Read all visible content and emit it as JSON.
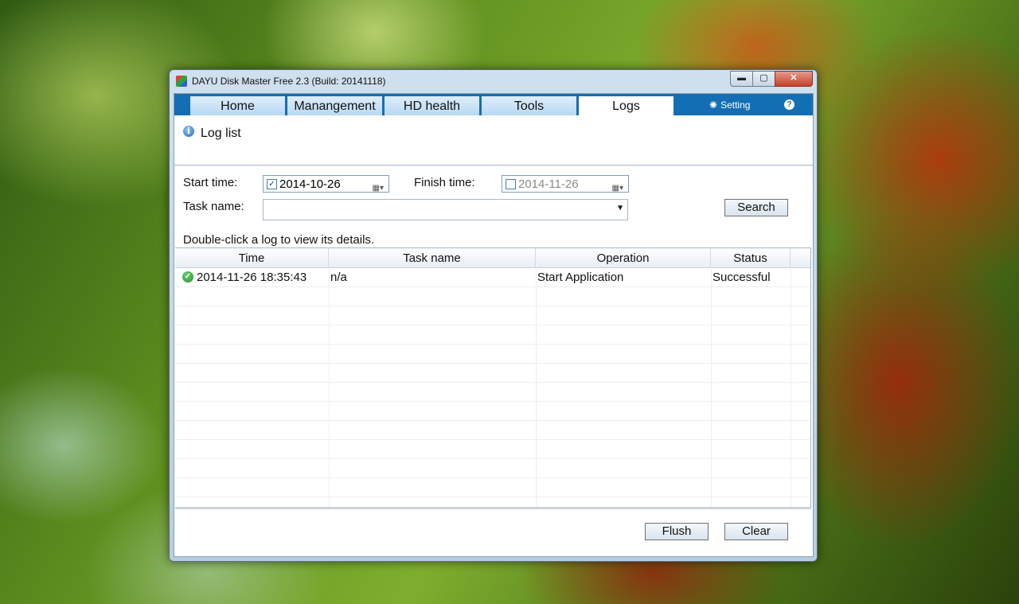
{
  "window": {
    "title": "DAYU Disk Master Free 2.3  (Build: 20141118)",
    "controls": {
      "minimize": "▬",
      "maximize": "▢",
      "close": "✕"
    }
  },
  "tabs": [
    {
      "label": "Home",
      "active": false
    },
    {
      "label": "Manangement",
      "active": false
    },
    {
      "label": "HD health",
      "active": false
    },
    {
      "label": "Tools",
      "active": false
    },
    {
      "label": "Logs",
      "active": true
    }
  ],
  "topbar": {
    "setting_label": "Setting",
    "help": "?"
  },
  "section": {
    "title": "Log list"
  },
  "filters": {
    "start_label": "Start time:",
    "start_value": "2014-10-26",
    "start_checked": true,
    "finish_label": "Finish time:",
    "finish_value": "2014-11-26",
    "finish_checked": false,
    "task_label": "Task name:",
    "task_value": "",
    "search_button": "Search"
  },
  "hint": "Double-click a log to view its details.",
  "table": {
    "columns": [
      "Time",
      "Task name",
      "Operation",
      "Status"
    ],
    "rows": [
      {
        "time": "2014-11-26 18:35:43",
        "task": "n/a",
        "operation": "Start Application",
        "status": "Successful"
      }
    ]
  },
  "footer": {
    "flush_button": "Flush",
    "clear_button": "Clear"
  },
  "colors": {
    "tabbar": "#146eb4",
    "status_ok": "#1f8f2a"
  }
}
